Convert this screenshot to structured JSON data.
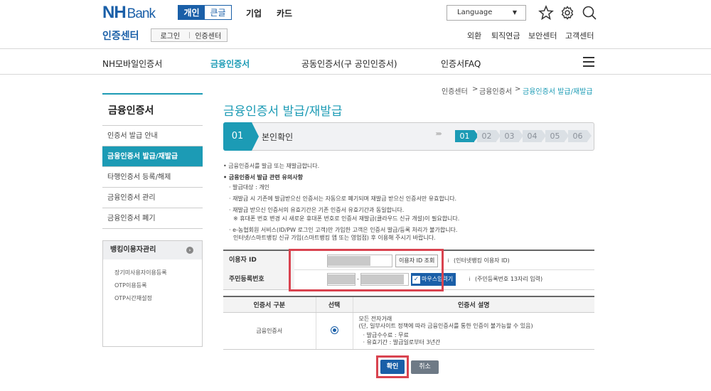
{
  "header": {
    "logo_nh": "NH",
    "logo_bank": "Bank",
    "segments": [
      "개인",
      "큰글"
    ],
    "top_nav": [
      "기업",
      "카드"
    ],
    "language": "Language",
    "cert_title": "인증센터",
    "login_links": [
      "로그인",
      "인증센터"
    ],
    "util_links": [
      "외환",
      "퇴직연금",
      "보안센터",
      "고객센터"
    ]
  },
  "gnb": {
    "items": [
      "NH모바일인증서",
      "금융인증서",
      "공동인증서(구 공인인증서)",
      "인증서FAQ"
    ],
    "active_index": 1
  },
  "breadcrumb": {
    "items": [
      "인증센터",
      "금융인증서",
      "금융인증서 발급/재발급"
    ],
    "separator": ">"
  },
  "sidebar": {
    "title": "금융인증서",
    "items": [
      "인증서 발급 안내",
      "금융인증서 발급/재발급",
      "타행인증서 등록/해제",
      "금융인증서 관리",
      "금융인증서 폐기"
    ],
    "active_index": 1,
    "box_title": "뱅킹이용자관리",
    "box_items": [
      "장기미사용자이용등록",
      "OTP이용등록",
      "OTP시간재설정"
    ]
  },
  "main": {
    "page_title": "금융인증서 발급/재발급",
    "step_number": "01",
    "step_label": "본인확인",
    "step_chips": [
      "01",
      "02",
      "03",
      "04",
      "05",
      "06"
    ],
    "active_chip": 0,
    "notices": [
      "금융인증서를 발급 또는 재발급합니다.",
      "금융인증서 발급 관련 유의사항",
      "발급대상 : 개인",
      "재발급 시 기존에 발급받으신 인증서는 자동으로 폐기되며 재발급 받으신 인증서만 유효합니다.",
      "재발급 받으신 인증서의 유효기간은 기존 인증서 유효기간과 동일합니다.",
      "※ 휴대폰 번호 변경 시 새로운 휴대폰 번호로 인증서 재발급(클라우드 신규 개설)이 필요합니다.",
      "e-농협회원 서비스(ID/PW 로그인 고객)만 가입한 고객은 인증서 발급/등록 처리가 불가합니다.",
      "인터넷/스마트뱅킹 신규 가입(스마트뱅킹 앱 또는 영업점) 후 이용해 주시기 바랍니다."
    ],
    "form": {
      "user_id_label": "이용자 ID",
      "lookup_button": "이용자 ID 조회",
      "user_id_info": "(인터넷뱅킹 이용자 ID)",
      "rrn_label": "주민등록번호",
      "mouse_input": "마우스입력기",
      "rrn_info": "(주민등록번호 13자리 입력)",
      "info_icon": "i",
      "dash": "-"
    },
    "cert_table": {
      "headers": [
        "인증서 구분",
        "선택",
        "인증서 설명"
      ],
      "row_type": "금융인증서",
      "desc_lines": [
        "모든 전자거래",
        "(단, 일부사이트 정책에 따라 금융인증서를 통한 인증이 불가능할 수 있음)",
        "발급수수료 : 무료",
        "유효기간 : 발급일로부터 3년간"
      ]
    },
    "confirm_button": "확인",
    "cancel_button": "취소"
  },
  "colors": {
    "brand_blue": "#1a5fa8",
    "teal": "#1c9bb5",
    "highlight_red": "#d9434f"
  }
}
